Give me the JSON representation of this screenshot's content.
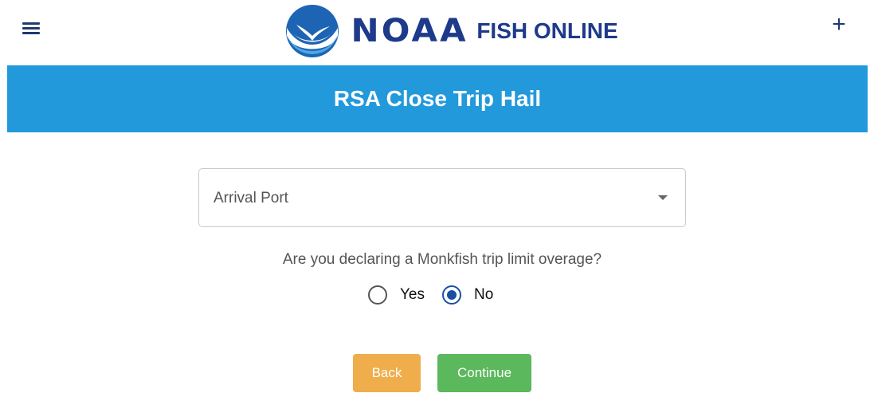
{
  "header": {
    "menu_icon": "hamburger-icon",
    "logo_emblem_icon": "noaa-emblem-icon",
    "logo_brand": "NOAA",
    "logo_product": "FISH ONLINE",
    "add_icon": "plus-icon",
    "add_label": "+"
  },
  "banner": {
    "title": "RSA Close Trip Hail",
    "color": "#2299db"
  },
  "form": {
    "arrival_port": {
      "label": "Arrival Port",
      "icon": "caret-down-icon"
    },
    "monkfish_question": "Are you declaring a Monkfish trip limit overage?",
    "options": [
      {
        "label": "Yes",
        "selected": false
      },
      {
        "label": "No",
        "selected": true
      }
    ]
  },
  "actions": {
    "back_label": "Back",
    "back_color": "#efad4b",
    "continue_label": "Continue",
    "continue_color": "#5cb85c"
  }
}
